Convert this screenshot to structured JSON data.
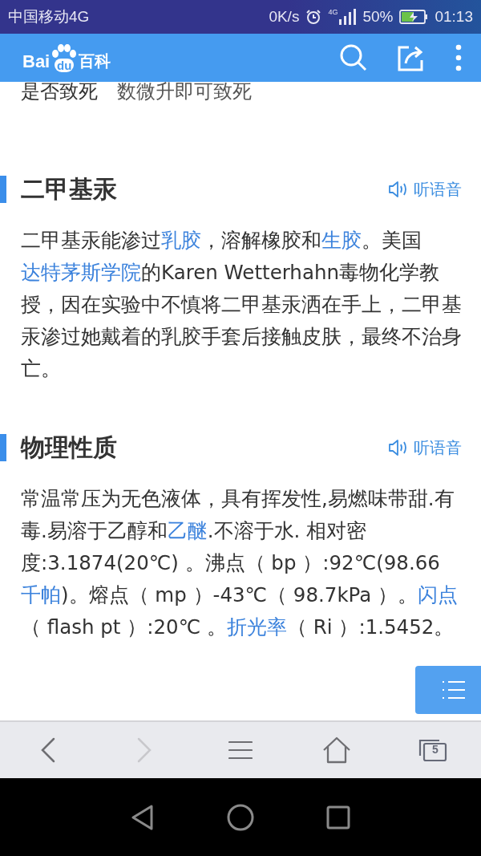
{
  "status_bar": {
    "carrier": "中国移动4G",
    "speed": "0K/s",
    "network_label": "4G",
    "battery_percent": "50%",
    "time": "01:13"
  },
  "header": {
    "logo": {
      "part_1": "Bai",
      "part_2": "du",
      "part_3": "百科"
    }
  },
  "info_row": {
    "label": "是否致死",
    "value": "数微升即可致死"
  },
  "sections": [
    {
      "title": "二甲基汞",
      "listen": "听语音",
      "paragraph": [
        {
          "text": "二甲基汞能渗过",
          "kind": "text"
        },
        {
          "text": "乳胶",
          "kind": "link"
        },
        {
          "text": "，溶解橡胶和",
          "kind": "text"
        },
        {
          "text": "生胶",
          "kind": "link"
        },
        {
          "text": "。美国",
          "kind": "text"
        },
        {
          "text": "达特茅斯学院",
          "kind": "link"
        },
        {
          "text": "的Karen Wetterhahn毒物化学教授，因在实验中不慎将二甲基汞洒在手上，二甲基汞渗过她戴着的乳胶手套后接触皮肤，最终不治身亡。",
          "kind": "text"
        }
      ]
    },
    {
      "title": "物理性质",
      "listen": "听语音",
      "paragraph": [
        {
          "text": "常温常压为无色液体，具有挥发性,易燃味带甜.有毒.易溶于乙醇和",
          "kind": "text"
        },
        {
          "text": "乙醚",
          "kind": "link"
        },
        {
          "text": ".不溶于水. 相对密度:3.1874(20℃) 。沸点（ bp ）:92℃(98.66",
          "kind": "text"
        },
        {
          "text": "千帕",
          "kind": "link"
        },
        {
          "text": ")。熔点（ mp ）-43℃（ 98.7kPa ）。",
          "kind": "text"
        },
        {
          "text": "闪点",
          "kind": "link"
        },
        {
          "text": "（ flash pt ）:20℃ 。",
          "kind": "text"
        },
        {
          "text": "折光率",
          "kind": "link"
        },
        {
          "text": "（ Ri ）:1.5452。",
          "kind": "text"
        }
      ]
    }
  ],
  "bottom_nav": [
    {
      "kind": "back",
      "disabled": false
    },
    {
      "kind": "forward",
      "disabled": true
    },
    {
      "kind": "menu",
      "disabled": false
    },
    {
      "kind": "home",
      "disabled": false
    },
    {
      "kind": "tabs",
      "disabled": false,
      "count": "5"
    }
  ]
}
